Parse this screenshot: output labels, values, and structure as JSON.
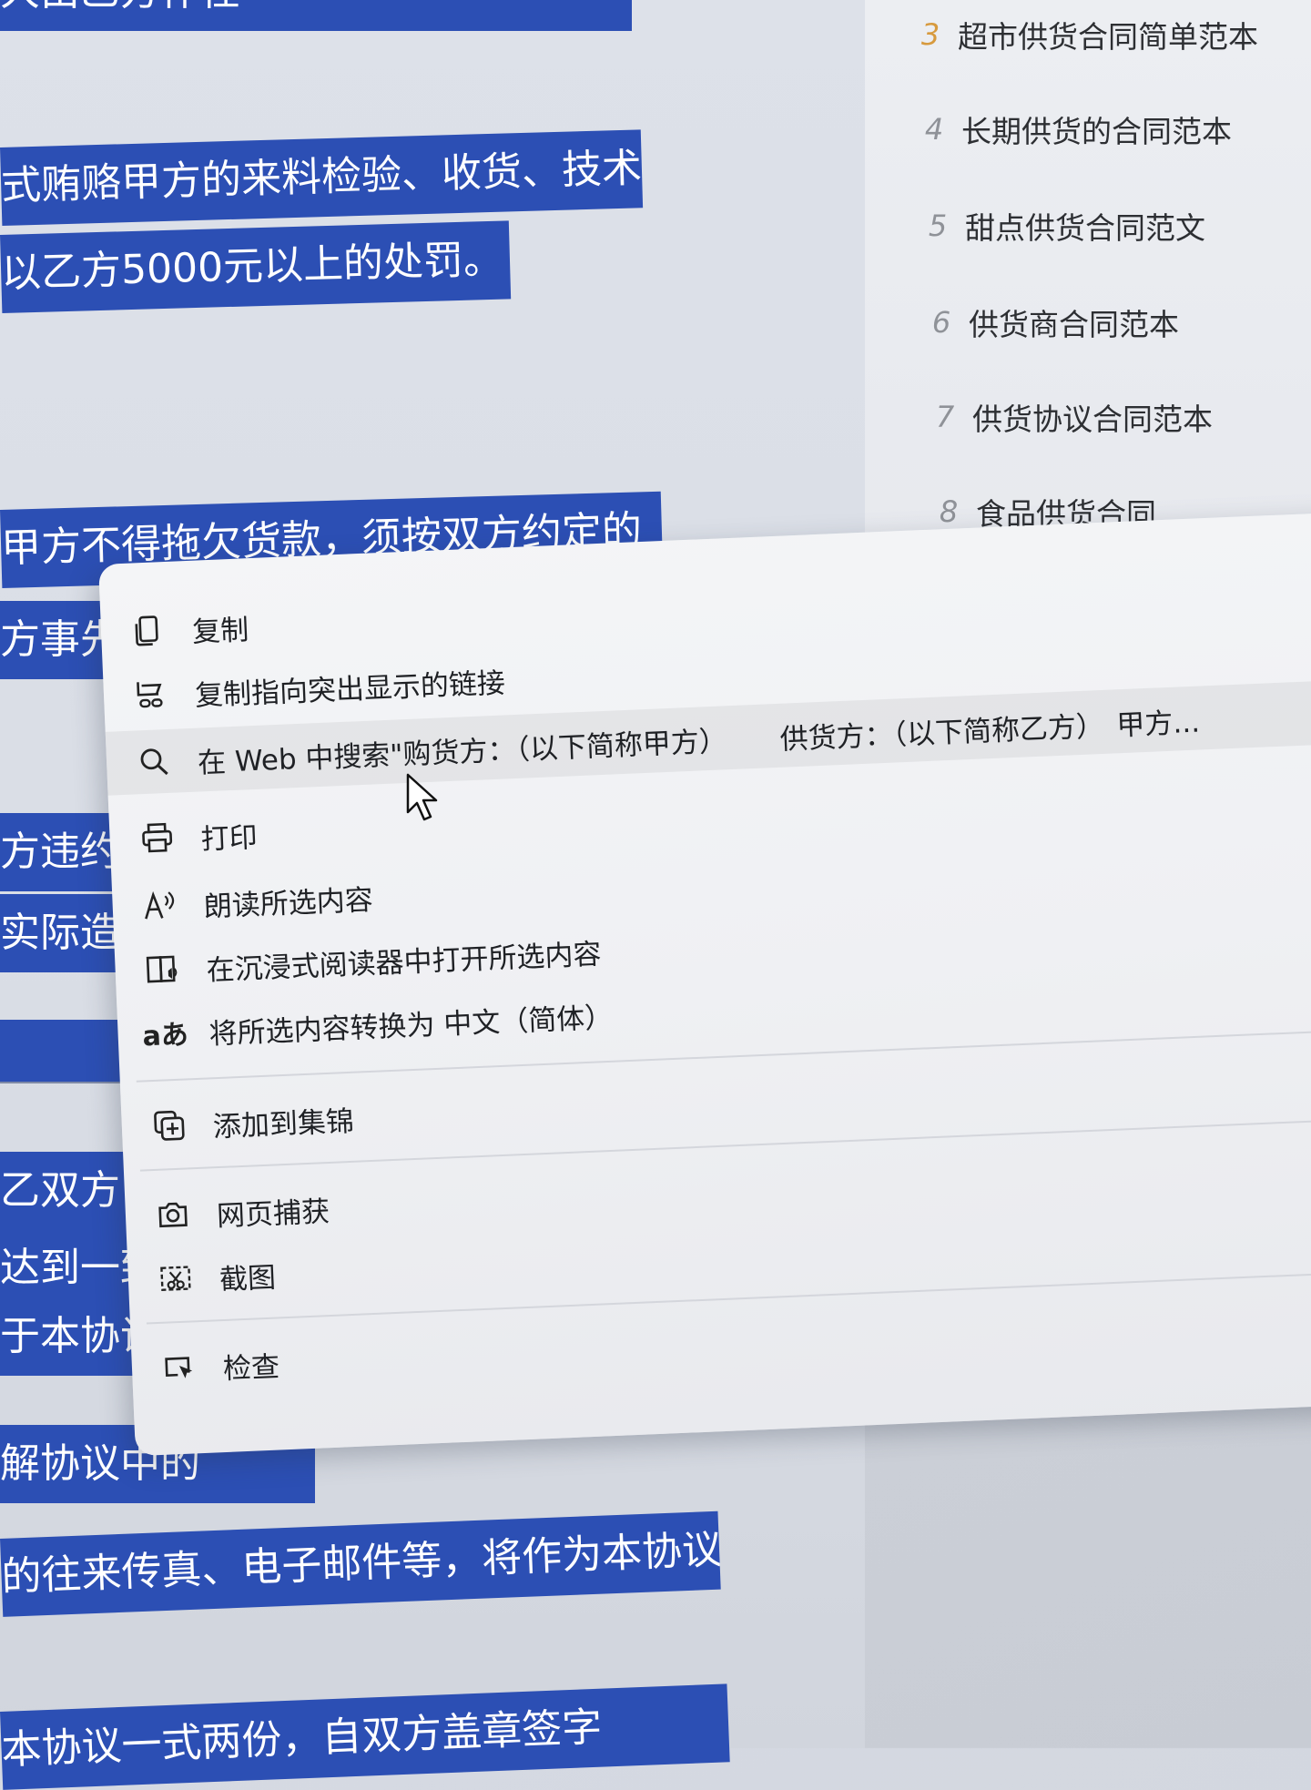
{
  "document": {
    "highlighted_lines": [
      "大由乙方作任",
      "式贿赂甲方的来料检验、收货、技术",
      "以乙方5000元以上的处罚。",
      "甲方不得拖欠货款，须按双方约定的",
      "方事先",
      "方违约，",
      "实际造成",
      "乙双方",
      "达到一致的",
      "于本协议除",
      "解协议中的",
      "的往来传真、电子邮件等，将作为本协议的",
      "本协议一式两份，自双方盖章签字"
    ]
  },
  "recommendations": {
    "items": [
      {
        "num": "3",
        "label": "超市供货合同简单范本",
        "hot": true
      },
      {
        "num": "4",
        "label": "长期供货的合同范本",
        "hot": false
      },
      {
        "num": "5",
        "label": "甜点供货合同范文",
        "hot": false
      },
      {
        "num": "6",
        "label": "供货商合同范本",
        "hot": false
      },
      {
        "num": "7",
        "label": "供货协议合同范本",
        "hot": false
      },
      {
        "num": "8",
        "label": "食品供货合同",
        "hot": false
      }
    ]
  },
  "context_menu": {
    "copy": "复制",
    "copy_link_to_highlight": "复制指向突出显示的链接",
    "search_web": "在 Web 中搜索\"购货方：（以下简称甲方）",
    "search_web_extra_1": "供货方：（以下简称乙方）",
    "search_web_extra_2": "甲方...",
    "print": "打印",
    "read_aloud": "朗读所选内容",
    "open_immersive_reader": "在沉浸式阅读器中打开所选内容",
    "translate": "将所选内容转换为 中文（简体）",
    "add_to_collections": "添加到集锦",
    "web_capture": "网页捕获",
    "screenshot": "截图",
    "inspect": "检查",
    "translate_icon_text": "aあ"
  },
  "colors": {
    "highlight": "#2c4fb4",
    "menu_bg": "#f2f3f5",
    "hot_number": "#d79a3e"
  }
}
